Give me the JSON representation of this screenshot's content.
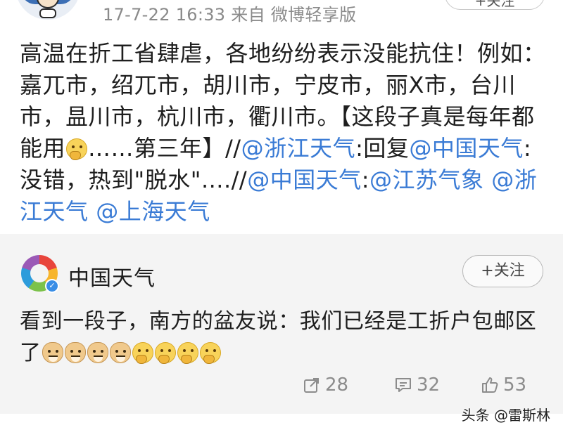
{
  "original_post": {
    "meta": "17-7-22 16:33  来自 微博轻享版",
    "follow_pill": "+关注",
    "segments": [
      {
        "type": "text",
        "text": "高温在折工省肆虐，各地纷纷表示没能抗住！例如：嘉兀市，绍兀市，胡川市，宁皮市，丽X市，台川市，昷川市，杭川市，衢川市。【这段子真是每年都能用"
      },
      {
        "type": "emoji",
        "name": "thinking-emoji"
      },
      {
        "type": "text",
        "text": "……第三年】//"
      },
      {
        "type": "mention",
        "text": "@浙江天气"
      },
      {
        "type": "text",
        "text": ":回复"
      },
      {
        "type": "mention",
        "text": "@中国天气"
      },
      {
        "type": "text",
        "text": ":没错，热到\"脱水\"....//"
      },
      {
        "type": "mention",
        "text": "@中国天气"
      },
      {
        "type": "text",
        "text": ":"
      },
      {
        "type": "mention",
        "text": "@江苏气象"
      },
      {
        "type": "text",
        "text": " "
      },
      {
        "type": "mention",
        "text": "@浙江天气"
      },
      {
        "type": "text",
        "text": " "
      },
      {
        "type": "mention",
        "text": "@上海天气"
      }
    ]
  },
  "retweet": {
    "author": "中国天气",
    "follow_label": "+关注",
    "text": "看到一段子，南方的盆友说：我们已经是工折户包邮区了",
    "emojis": [
      "doge-emoji",
      "doge-emoji",
      "doge-emoji",
      "doge-emoji",
      "thinking-emoji",
      "thinking-emoji",
      "thinking-emoji",
      "thinking-emoji"
    ],
    "reposts": "28",
    "comments": "32",
    "likes": "53"
  },
  "watermark": "头条 @雷斯林",
  "colors": {
    "mention": "#3a7bd5",
    "meta_gray": "#8a8a8a",
    "card_bg": "#f4f4f4"
  }
}
